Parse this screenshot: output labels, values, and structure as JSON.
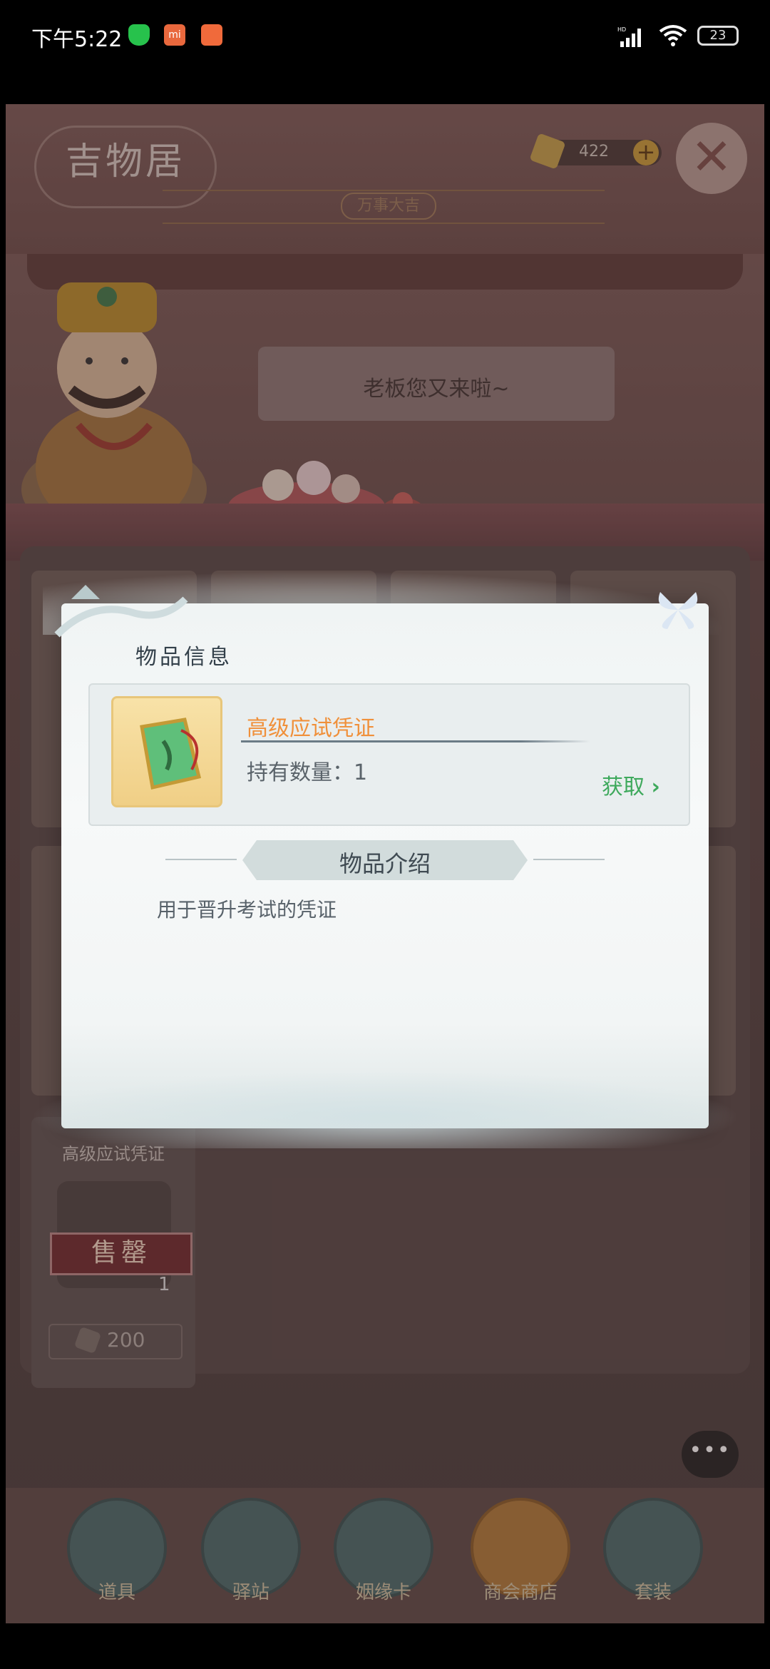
{
  "status_bar": {
    "time": "下午5:22",
    "network_badge": "HD",
    "battery": "23",
    "icons": [
      "shield-icon",
      "mi-icon",
      "mail-icon",
      "signal-icon",
      "wifi-icon",
      "battery-icon"
    ]
  },
  "header": {
    "title": "吉物居",
    "banner": "万事大吉",
    "currency_value": "422",
    "plus_label": "+",
    "close_label": "✕"
  },
  "merchant": {
    "greeting": "老板您又来啦~"
  },
  "sold_item": {
    "name": "高级应试凭证",
    "badge": "售罄",
    "quantity": "1",
    "price": "200"
  },
  "chat_button": "•••",
  "modal": {
    "title": "物品信息",
    "item": {
      "name": "高级应试凭证",
      "quantity_label": "持有数量：1",
      "get_label": "获取",
      "icon": "jade-token-icon"
    },
    "intro_title": "物品介绍",
    "description": "用于晋升考试的凭证"
  },
  "nav": [
    {
      "label": "道具",
      "icon": "mortar-icon"
    },
    {
      "label": "驿站",
      "icon": "station-icon"
    },
    {
      "label": "姻缘卡",
      "icon": "card-icon"
    },
    {
      "label": "商会商店",
      "icon": "shop-icon"
    },
    {
      "label": "套装",
      "icon": "outfit-icon"
    }
  ],
  "colors": {
    "accent_orange": "#f0903a",
    "accent_green": "#3ea95c"
  }
}
